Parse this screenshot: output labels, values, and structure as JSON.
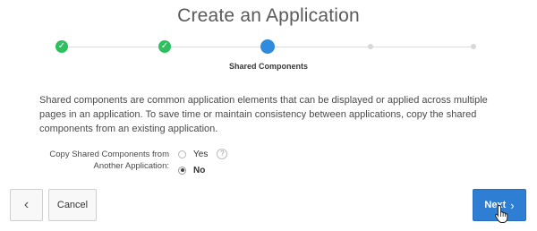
{
  "page": {
    "title": "Create an Application"
  },
  "wizard": {
    "steps": [
      {
        "state": "done",
        "icon": "check-icon"
      },
      {
        "state": "done",
        "icon": "check-icon"
      },
      {
        "state": "active",
        "label": "Shared Components"
      },
      {
        "state": "future"
      },
      {
        "state": "future"
      }
    ],
    "active_label": "Shared Components",
    "colors": {
      "done": "#2ebf5f",
      "active": "#2e8bde",
      "future": "#d8d8d8"
    }
  },
  "description": "Shared components are common application elements that can be displayed or applied across multiple pages in an application. To save time or maintain consistency between applications, copy the shared components from an existing application.",
  "form": {
    "label": "Copy Shared Components from Another Application:",
    "options": [
      {
        "label": "Yes",
        "selected": false
      },
      {
        "label": "No",
        "selected": true
      }
    ],
    "help_icon": "?"
  },
  "buttons": {
    "back_icon": "‹",
    "cancel": "Cancel",
    "next": "Next",
    "next_icon": "›"
  }
}
